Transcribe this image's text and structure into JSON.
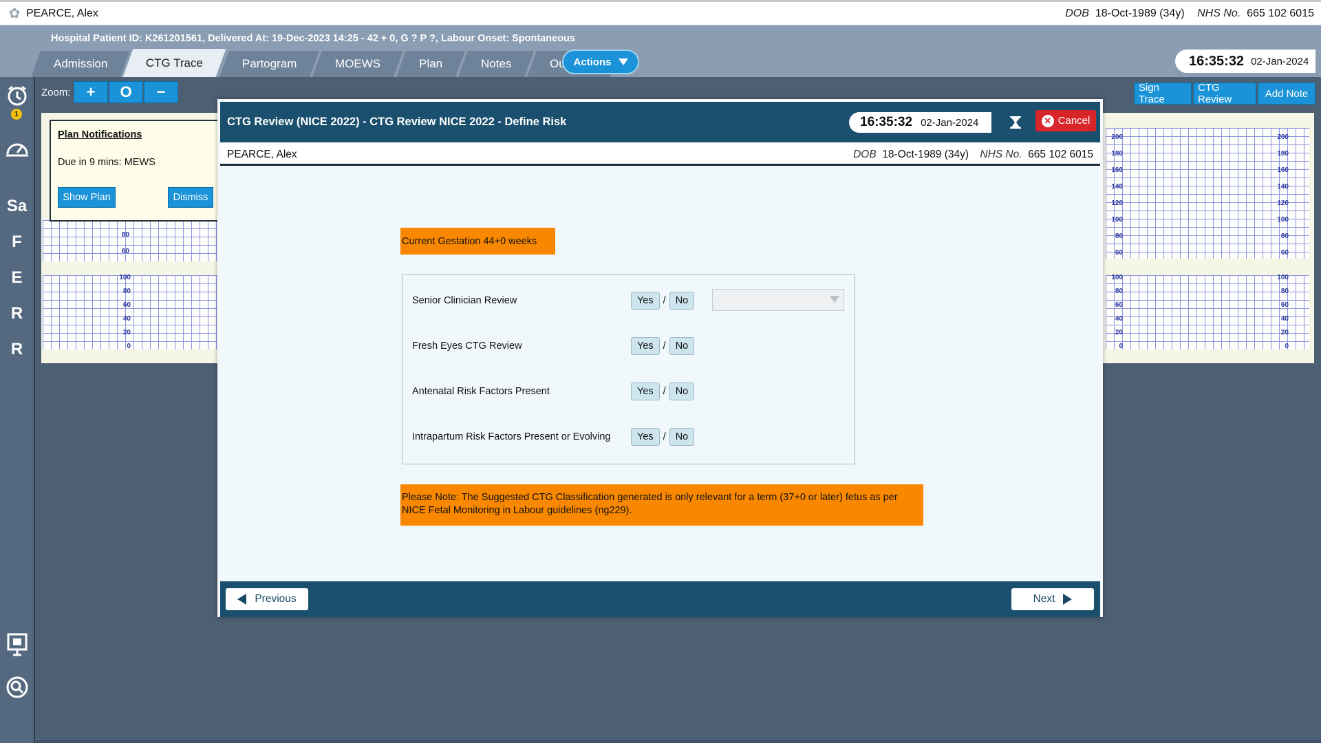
{
  "patient": {
    "name": "PEARCE, Alex",
    "dob_label": "DOB",
    "dob": "18-Oct-1989 (34y)",
    "nhs_label": "NHS No.",
    "nhs": "665 102 6015"
  },
  "header": {
    "info": "Hospital Patient ID: K261201561, Delivered At: 19-Dec-2023 14:25 - 42 + 0, G ? P ?,   Labour Onset: Spontaneous",
    "tabs": [
      "Admission",
      "CTG Trace",
      "Partogram",
      "MOEWS",
      "Plan",
      "Notes",
      "Outcome"
    ],
    "active_tab": "CTG Trace",
    "actions_label": "Actions",
    "time": "16:35:32",
    "date": "02-Jan-2024"
  },
  "rail": {
    "alarm_badge": "1",
    "letters": [
      "Sa",
      "F",
      "E",
      "R",
      "R"
    ]
  },
  "toolbar": {
    "zoom_label": "Zoom:",
    "zoom_in": "+",
    "zoom_reset": "O",
    "zoom_out": "−",
    "sign_trace": "Sign Trace",
    "ctg_review": "CTG Review",
    "add_note": "Add Note"
  },
  "ctg_scales": {
    "fhr_ticks": [
      "200",
      "180",
      "160",
      "140",
      "120",
      "100",
      "80",
      "60"
    ],
    "left_fhr_ticks": [
      "80",
      "60"
    ],
    "toco_ticks": [
      "100",
      "80",
      "60",
      "40",
      "20",
      "0"
    ]
  },
  "plan_notifications": {
    "title": "Plan Notifications",
    "due": "Due in 9 mins: MEWS",
    "show_plan": "Show Plan",
    "dismiss": "Dismiss"
  },
  "modal": {
    "title": "CTG Review (NICE 2022) - CTG Review NICE 2022 - Define Risk",
    "time": "16:35:32",
    "date": "02-Jan-2024",
    "cancel": "Cancel",
    "gestation": "Current Gestation 44+0 weeks",
    "questions": [
      {
        "label": "Senior Clinician Review",
        "yes": "Yes",
        "no": "No"
      },
      {
        "label": "Fresh Eyes CTG Review",
        "yes": "Yes",
        "no": "No"
      },
      {
        "label": "Antenatal Risk Factors Present",
        "yes": "Yes",
        "no": "No"
      },
      {
        "label": "Intrapartum Risk Factors Present or Evolving",
        "yes": "Yes",
        "no": "No"
      }
    ],
    "slash": "/",
    "senior_select_value": "",
    "note": "Please Note: The Suggested CTG Classification generated is only relevant for a term (37+0 or later) fetus as per NICE Fetal Monitoring in Labour guidelines (ng229).",
    "previous": "Previous",
    "next": "Next"
  }
}
